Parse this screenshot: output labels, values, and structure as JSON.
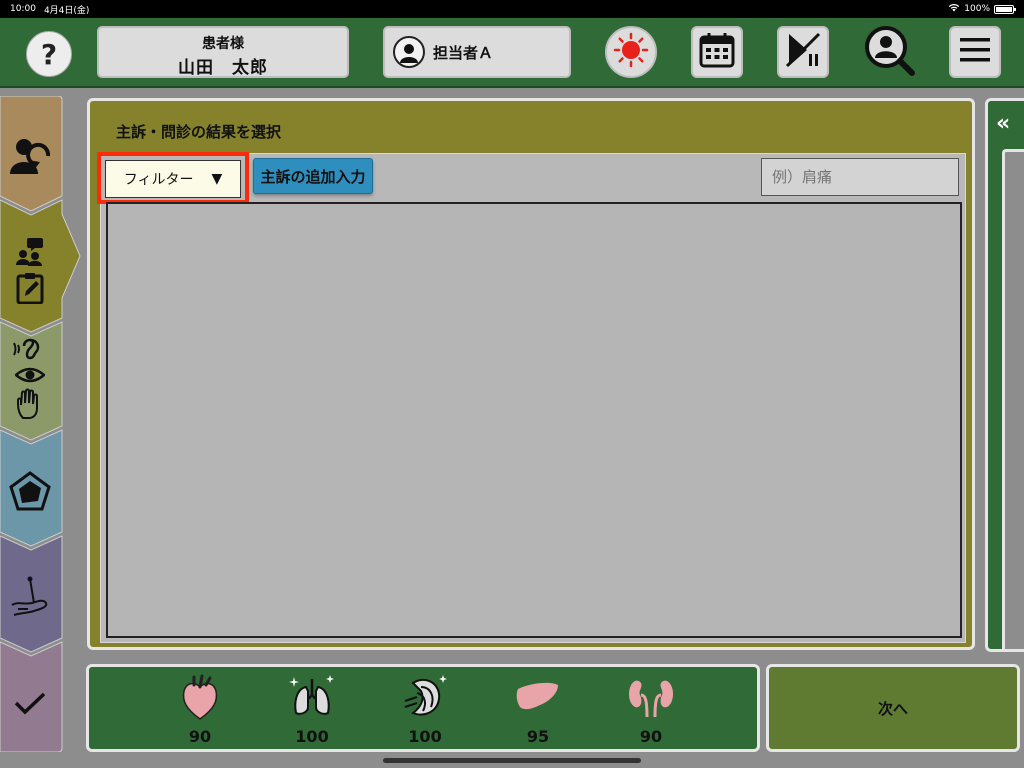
{
  "status": {
    "time": "10:00",
    "date": "4月4日(金)",
    "battery": "100%",
    "battery_level": 1.0
  },
  "header": {
    "help": "?",
    "patient_label": "患者様",
    "patient_name": "山田　太郎",
    "staff_name": "担当者Ａ",
    "icons": [
      "help-icon",
      "sun-icon",
      "calendar-icon",
      "play-pause-icon",
      "search-user-icon",
      "menu-icon"
    ]
  },
  "sidebar": {
    "items": [
      {
        "icon": "patient-return-icon",
        "color": "#a88a5c"
      },
      {
        "icon": "interview-icon",
        "color": "#85822b",
        "active": true
      },
      {
        "icon": "senses-icon",
        "color": "#8c9a6a"
      },
      {
        "icon": "pentagon-chart-icon",
        "color": "#6b97a9"
      },
      {
        "icon": "treatment-icon",
        "color": "#6f6a8c"
      },
      {
        "icon": "check-icon",
        "color": "#927a90"
      }
    ]
  },
  "main": {
    "title": "主訴・問診の結果を選択",
    "filter_label": "フィルター",
    "filter_arrow": "▼",
    "add_button": "主訴の追加入力",
    "search_placeholder": "例）肩痛"
  },
  "right_tab": {
    "label": "«"
  },
  "vitals": [
    {
      "icon": "heart-icon",
      "value": "90"
    },
    {
      "icon": "lungs-icon",
      "value": "100"
    },
    {
      "icon": "muscle-icon",
      "value": "100"
    },
    {
      "icon": "liver-icon",
      "value": "95"
    },
    {
      "icon": "kidneys-icon",
      "value": "90"
    }
  ],
  "footer": {
    "next_label": "次へ"
  },
  "colors": {
    "accent_green": "#2f6a37",
    "panel_olive": "#85822b",
    "highlight_red": "#ff2a0a",
    "button_blue": "#2e8fbf"
  }
}
